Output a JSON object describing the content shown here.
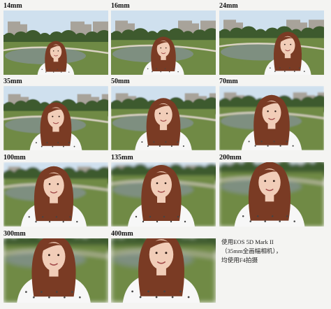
{
  "photos": [
    {
      "label": "14mm"
    },
    {
      "label": "16mm"
    },
    {
      "label": "24mm"
    },
    {
      "label": "35mm"
    },
    {
      "label": "50mm"
    },
    {
      "label": "70mm"
    },
    {
      "label": "100mm"
    },
    {
      "label": "135mm"
    },
    {
      "label": "200mm"
    },
    {
      "label": "300mm"
    },
    {
      "label": "400mm"
    }
  ],
  "note": {
    "line1": "使用EOS 5D Mark II",
    "line2": "（35mm全画幅相机），",
    "line3": "均使用F4拍摄"
  },
  "colors": {
    "sky": "#cfe0ee",
    "hair": "#7a3b24",
    "skin": "#f1cdb8",
    "shirt": "#f7f7f7",
    "grass": "#6f8a45",
    "water": "#7e8f80",
    "building": "#a8a39a",
    "tree": "#3e5a2e"
  }
}
